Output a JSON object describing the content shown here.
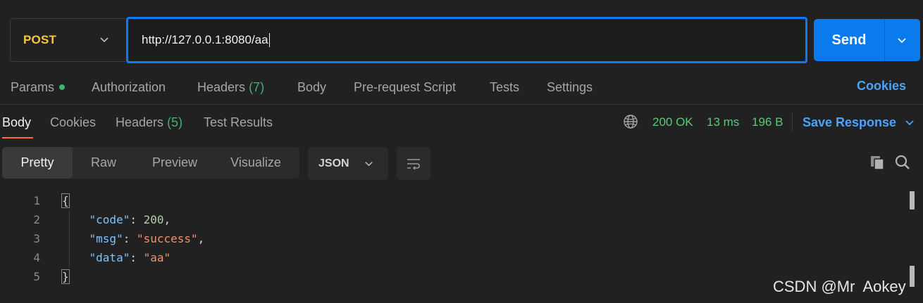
{
  "request": {
    "method": "POST",
    "url": "http://127.0.0.1:8080/aa",
    "send_label": "Send"
  },
  "request_tabs": {
    "params": "Params",
    "authorization": "Authorization",
    "headers": "Headers",
    "headers_count": "(7)",
    "body": "Body",
    "prerequest": "Pre-request Script",
    "tests": "Tests",
    "settings": "Settings",
    "cookies": "Cookies"
  },
  "response_tabs": {
    "body": "Body",
    "cookies": "Cookies",
    "headers": "Headers",
    "headers_count": "(5)",
    "test_results": "Test Results"
  },
  "response_status": {
    "status": "200 OK",
    "time": "13 ms",
    "size": "196 B",
    "save_label": "Save Response"
  },
  "view_modes": {
    "pretty": "Pretty",
    "raw": "Raw",
    "preview": "Preview",
    "visualize": "Visualize",
    "format": "JSON"
  },
  "code": {
    "line_numbers": [
      "1",
      "2",
      "3",
      "4",
      "5"
    ],
    "open_brace": "{",
    "close_brace": "}",
    "code_key": "\"code\"",
    "code_value": "200",
    "msg_key": "\"msg\"",
    "msg_value": "\"success\"",
    "data_key": "\"data\"",
    "data_value": "\"aa\""
  },
  "watermark": "CSDN @Mr  Aokey",
  "colors": {
    "accent_blue": "#097bed",
    "method_yellow": "#ffc53d",
    "status_green": "#5cc77a",
    "active_tab_orange": "#ff6c37"
  },
  "icons": [
    "chevron-down-icon",
    "globe-icon",
    "wrap-lines-icon",
    "copy-icon",
    "search-icon"
  ]
}
